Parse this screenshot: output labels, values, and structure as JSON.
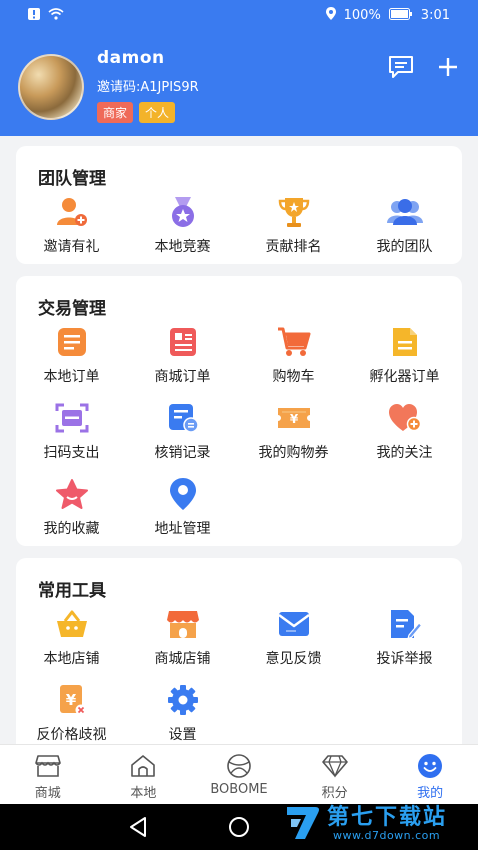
{
  "status_bar": {
    "battery": "100%",
    "time": "3:01"
  },
  "profile": {
    "username": "damon",
    "invite_label": "邀请码:",
    "invite_code": "A1JPIS9R",
    "tags": [
      "商家",
      "个人"
    ]
  },
  "team": {
    "title": "团队管理",
    "items": [
      {
        "label": "邀请有礼",
        "icon": "invite-user-icon"
      },
      {
        "label": "本地竞赛",
        "icon": "medal-icon"
      },
      {
        "label": "贡献排名",
        "icon": "trophy-icon"
      },
      {
        "label": "我的团队",
        "icon": "team-icon"
      }
    ]
  },
  "trade": {
    "title": "交易管理",
    "items": [
      {
        "label": "本地订单",
        "icon": "order-list-icon"
      },
      {
        "label": "商城订单",
        "icon": "mall-order-icon"
      },
      {
        "label": "购物车",
        "icon": "cart-icon"
      },
      {
        "label": "孵化器订单",
        "icon": "document-icon"
      },
      {
        "label": "扫码支出",
        "icon": "scan-icon"
      },
      {
        "label": "核销记录",
        "icon": "record-icon"
      },
      {
        "label": "我的购物券",
        "icon": "coupon-icon"
      },
      {
        "label": "我的关注",
        "icon": "heart-plus-icon"
      },
      {
        "label": "我的收藏",
        "icon": "star-icon"
      },
      {
        "label": "地址管理",
        "icon": "location-pin-icon"
      }
    ]
  },
  "tools": {
    "title": "常用工具",
    "items": [
      {
        "label": "本地店铺",
        "icon": "basket-icon"
      },
      {
        "label": "商城店铺",
        "icon": "storefront-icon"
      },
      {
        "label": "意见反馈",
        "icon": "mail-icon"
      },
      {
        "label": "投诉举报",
        "icon": "edit-document-icon"
      },
      {
        "label": "反价格歧视",
        "icon": "price-tag-icon"
      },
      {
        "label": "设置",
        "icon": "gear-icon"
      }
    ]
  },
  "tabbar": {
    "items": [
      {
        "label": "商城",
        "icon": "shop-icon"
      },
      {
        "label": "本地",
        "icon": "home-icon"
      },
      {
        "label": "BOBOME",
        "icon": "ball-icon"
      },
      {
        "label": "积分",
        "icon": "diamond-icon"
      },
      {
        "label": "我的",
        "icon": "smile-icon",
        "active": true
      }
    ]
  },
  "watermark": {
    "title": "第七下载站",
    "url": "www.d7down.com"
  },
  "colors": {
    "primary": "#3a7bf0",
    "orange": "#f58b3a",
    "purple": "#8b6ee6",
    "red": "#ef5a5a",
    "active_tab": "#2f6ff0"
  }
}
